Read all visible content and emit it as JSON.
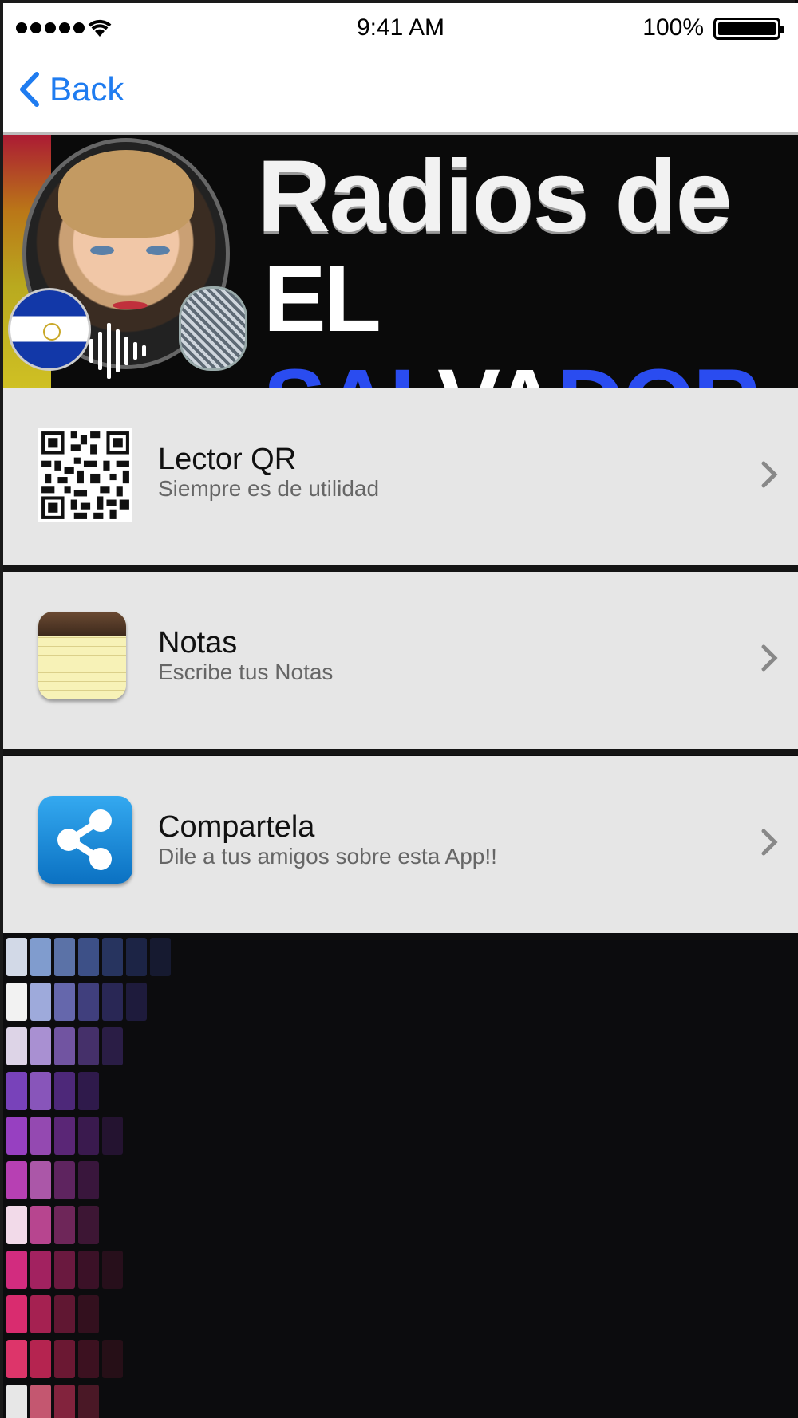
{
  "status_bar": {
    "time": "9:41 AM",
    "battery_percent": "100%"
  },
  "nav": {
    "back_label": "Back",
    "accent_color": "#1f7cf0"
  },
  "banner": {
    "title_line1": "Radios de",
    "title_line2_white_1": "EL ",
    "title_line2_blue_1": "SAL",
    "title_line2_white_2": "VA",
    "title_line2_blue_2": "DOR"
  },
  "menu": {
    "items": [
      {
        "icon": "qr-code-icon",
        "title": "Lector QR",
        "subtitle": "Siempre es de utilidad"
      },
      {
        "icon": "notes-icon",
        "title": "Notas",
        "subtitle": "Escribe tus Notas"
      },
      {
        "icon": "share-icon",
        "title": "Compartela",
        "subtitle": "Dile a tus amigos sobre esta App!!"
      }
    ]
  }
}
